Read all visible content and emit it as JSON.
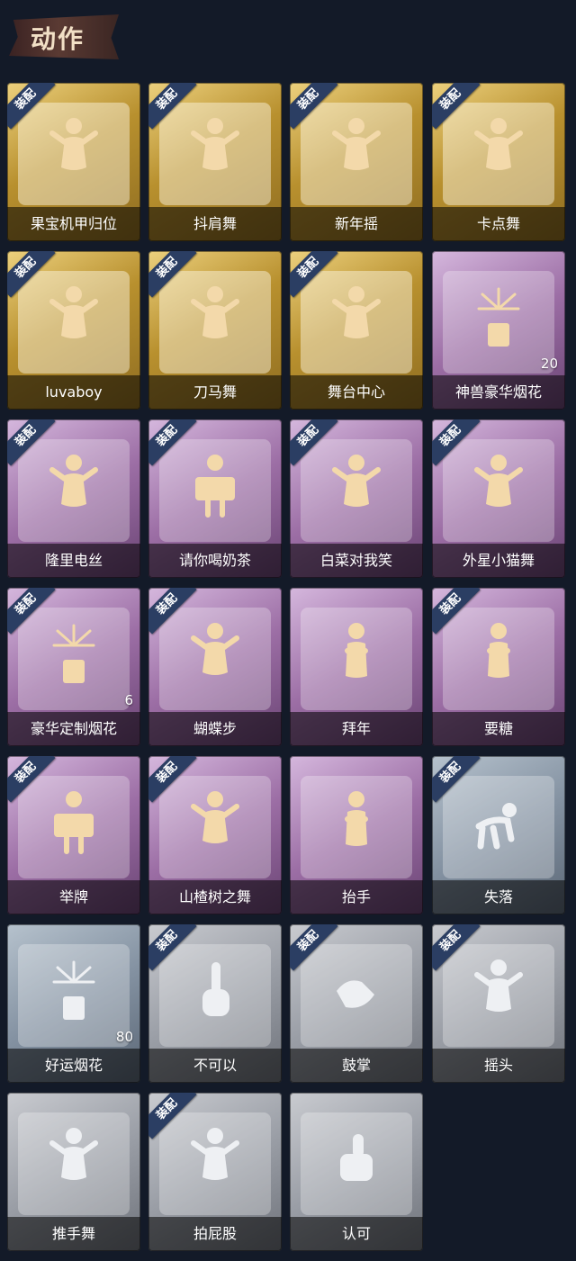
{
  "section_title": "动作",
  "equip_badge_label": "装配",
  "colors": {
    "gold": "#c9a441",
    "purple": "#a879b1",
    "blue": "#8e9cab",
    "gray": "#a3a7ae",
    "badge": "#2b3e63"
  },
  "items": [
    {
      "label": "果宝机甲归位",
      "rarity": "gold",
      "equipped": true,
      "icon": "figure-dance-icon"
    },
    {
      "label": "抖肩舞",
      "rarity": "gold",
      "equipped": true,
      "icon": "figure-dance-icon"
    },
    {
      "label": "新年摇",
      "rarity": "gold",
      "equipped": true,
      "icon": "figure-dance-icon"
    },
    {
      "label": "卡点舞",
      "rarity": "gold",
      "equipped": true,
      "icon": "figure-dance-icon"
    },
    {
      "label": "luvaboy",
      "rarity": "gold",
      "equipped": true,
      "icon": "figure-dance-icon"
    },
    {
      "label": "刀马舞",
      "rarity": "gold",
      "equipped": true,
      "icon": "figure-dance-icon"
    },
    {
      "label": "舞台中心",
      "rarity": "gold",
      "equipped": true,
      "icon": "figure-dance-icon"
    },
    {
      "label": "神兽豪华烟花",
      "rarity": "purple",
      "equipped": false,
      "icon": "fireworks-icon",
      "count": "20"
    },
    {
      "label": "隆里电丝",
      "rarity": "purple",
      "equipped": true,
      "icon": "figure-dance-icon"
    },
    {
      "label": "请你喝奶茶",
      "rarity": "purple",
      "equipped": true,
      "icon": "figure-sign-icon"
    },
    {
      "label": "白菜对我笑",
      "rarity": "purple",
      "equipped": true,
      "icon": "figure-dance-icon"
    },
    {
      "label": "外星小猫舞",
      "rarity": "purple",
      "equipped": true,
      "icon": "figure-dance-icon"
    },
    {
      "label": "豪华定制烟花",
      "rarity": "purple",
      "equipped": true,
      "icon": "fireworks-icon",
      "count": "6"
    },
    {
      "label": "蝴蝶步",
      "rarity": "purple",
      "equipped": true,
      "icon": "figure-dance-icon"
    },
    {
      "label": "拜年",
      "rarity": "purple",
      "equipped": false,
      "icon": "figure-bow-icon"
    },
    {
      "label": "要糖",
      "rarity": "purple",
      "equipped": true,
      "icon": "figure-bow-icon"
    },
    {
      "label": "举牌",
      "rarity": "purple",
      "equipped": true,
      "icon": "figure-sign-icon"
    },
    {
      "label": "山楂树之舞",
      "rarity": "purple",
      "equipped": true,
      "icon": "figure-dance-icon"
    },
    {
      "label": "抬手",
      "rarity": "purple",
      "equipped": false,
      "icon": "figure-bow-icon"
    },
    {
      "label": "失落",
      "rarity": "blue",
      "equipped": true,
      "icon": "figure-crawl-icon"
    },
    {
      "label": "好运烟花",
      "rarity": "blue",
      "equipped": false,
      "icon": "fireworks-icon",
      "count": "80"
    },
    {
      "label": "不可以",
      "rarity": "gray",
      "equipped": true,
      "icon": "hand-point-icon"
    },
    {
      "label": "鼓掌",
      "rarity": "gray",
      "equipped": true,
      "icon": "hands-clap-icon"
    },
    {
      "label": "摇头",
      "rarity": "gray",
      "equipped": true,
      "icon": "figure-dance-icon"
    },
    {
      "label": "推手舞",
      "rarity": "gray",
      "equipped": false,
      "icon": "figure-dance-icon"
    },
    {
      "label": "拍屁股",
      "rarity": "gray",
      "equipped": true,
      "icon": "figure-dance-icon"
    },
    {
      "label": "认可",
      "rarity": "gray",
      "equipped": false,
      "icon": "thumbs-up-icon"
    }
  ]
}
